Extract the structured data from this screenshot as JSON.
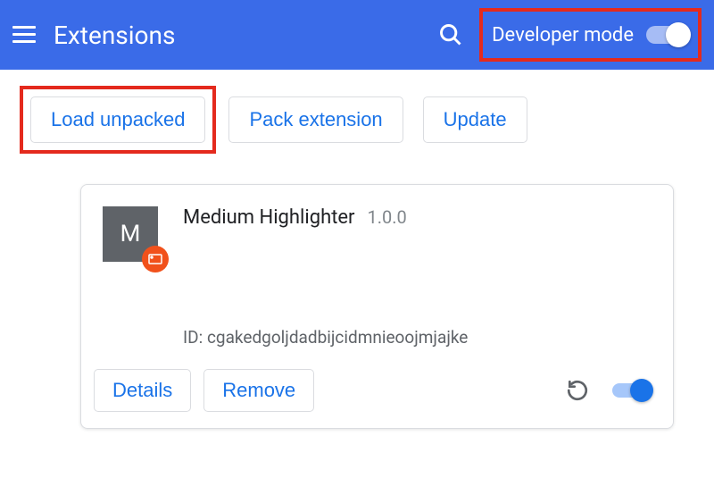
{
  "header": {
    "title": "Extensions",
    "dev_mode_label": "Developer mode",
    "dev_mode_on": true
  },
  "toolbar": {
    "load_unpacked": "Load unpacked",
    "pack_extension": "Pack extension",
    "update": "Update"
  },
  "extension": {
    "icon_letter": "M",
    "name": "Medium Highlighter",
    "version": "1.0.0",
    "id_label": "ID:",
    "id_value": "cgakedgoljdadbijcidmnieoojmjajke",
    "details": "Details",
    "remove": "Remove",
    "enabled": true
  },
  "highlights": {
    "load_unpacked_highlighted": true,
    "dev_mode_highlighted": true
  }
}
